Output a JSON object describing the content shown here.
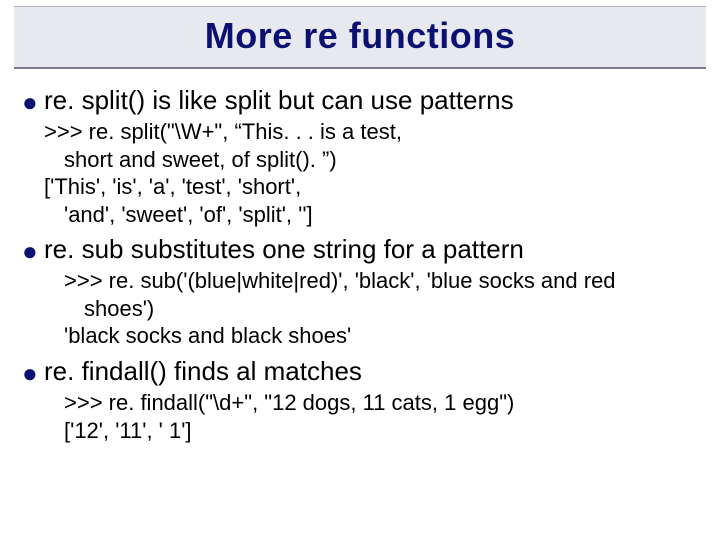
{
  "title": "More re functions",
  "items": [
    {
      "heading": "re. split() is like split but can use patterns",
      "lines": [
        {
          "text": ">>> re. split(\"\\W+\", “This. . . is a test,",
          "indent": 0
        },
        {
          "text": "short and sweet, of split(). ”)",
          "indent": 1
        },
        {
          "text": "['This', 'is', 'a', 'test', 'short',",
          "indent": 0
        },
        {
          "text": "'and', 'sweet', 'of', 'split', '']",
          "indent": 1
        }
      ]
    },
    {
      "heading": "re. sub substitutes one string for a pattern",
      "lines": [
        {
          "text": ">>> re. sub('(blue|white|red)', 'black', 'blue socks and red",
          "indent": 1
        },
        {
          "text": "shoes')",
          "indent": 2
        },
        {
          "text": "'black socks and black shoes'",
          "indent": 1
        }
      ]
    },
    {
      "heading": "re. findall() finds al matches",
      "lines": [
        {
          "text": ">>> re. findall(\"\\d+\", \"12 dogs, 11 cats, 1 egg\")",
          "indent": 1
        },
        {
          "text": "['12', '11', ' 1']",
          "indent": 1
        }
      ]
    }
  ]
}
